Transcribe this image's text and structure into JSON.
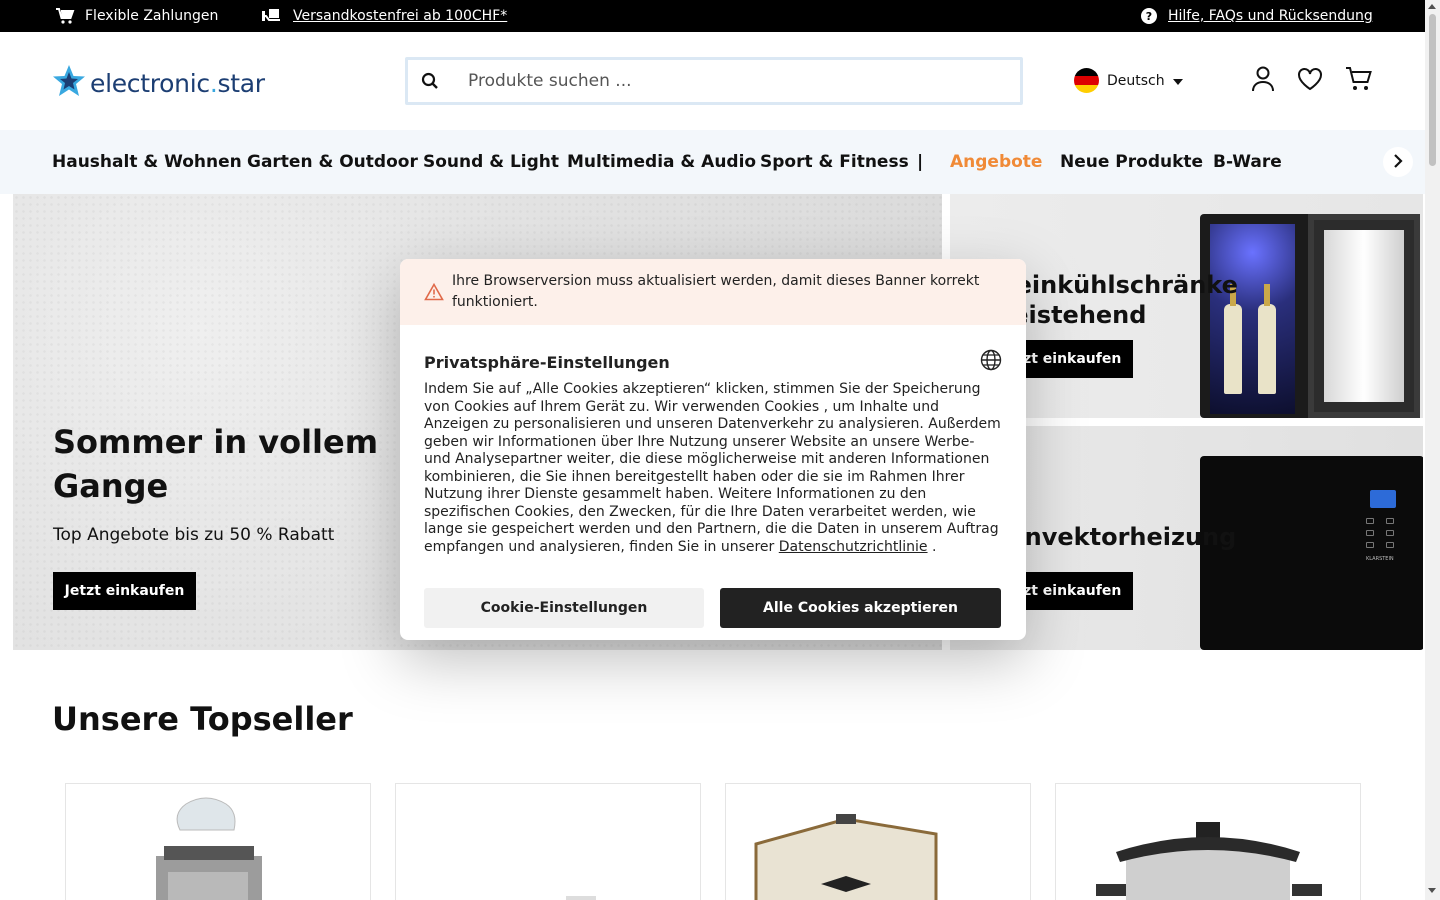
{
  "topbar": {
    "payments": "Flexible Zahlungen",
    "shipping": "Versandkostenfrei ab 100CHF*",
    "help": "Hilfe, FAQs und Rücksendung"
  },
  "header": {
    "logo_main": "electronic",
    "logo_dot": ".",
    "logo_end": "star",
    "search_placeholder": "Produkte suchen ...",
    "language": "Deutsch"
  },
  "nav": {
    "items": [
      "Haushalt & Wohnen",
      "Garten & Outdoor",
      "Sound & Light",
      "Multimedia & Audio",
      "Sport & Fitness",
      "|",
      "Angebote",
      "Neue Produkte",
      "B-Ware"
    ],
    "highlight_color": "#f08a37"
  },
  "hero": {
    "title": "Sommer in vollem Gange",
    "subtitle": "Top Angebote bis zu 50 % Rabatt",
    "cta": "Jetzt einkaufen",
    "side_top_title_line1": "Weinkühlschränke",
    "side_top_title_line2": "freistehend",
    "side_top_cta": "Jetzt einkaufen",
    "side_bottom_title": "Konvektorheizung",
    "side_bottom_cta": "Jetzt einkaufen",
    "heater_brand": "KLARSTEIN"
  },
  "modal": {
    "warning": "Ihre Browserversion muss aktualisiert werden, damit dieses Banner korrekt funktioniert.",
    "title": "Privatsphäre-Einstellungen",
    "body": "Indem Sie auf „Alle Cookies akzeptieren“ klicken, stimmen Sie der Speicherung von Cookies auf Ihrem Gerät zu. Wir verwenden Cookies , um Inhalte und Anzeigen zu personalisieren und unseren Datenverkehr zu analysieren. Außerdem geben wir Informationen über Ihre Nutzung unserer Website an unsere Werbe- und Analysepartner weiter, die diese möglicherweise mit anderen Informationen kombinieren, die Sie ihnen bereitgestellt haben oder die sie im Rahmen Ihrer Nutzung ihrer Dienste gesammelt haben. Weitere Informationen zu den spezifischen Cookies, den Zwecken, für die Ihre Daten verarbeitet werden, wie lange sie gespeichert werden und den Partnern, die die Daten in unserem Auftrag empfangen und analysieren, finden Sie in unserer",
    "privacy_link": "Datenschutzrichtlinie",
    "body_end": " .",
    "btn_settings": "Cookie-Einstellungen",
    "btn_accept": "Alle Cookies akzeptieren"
  },
  "topseller": {
    "title": "Unsere Topseller"
  }
}
